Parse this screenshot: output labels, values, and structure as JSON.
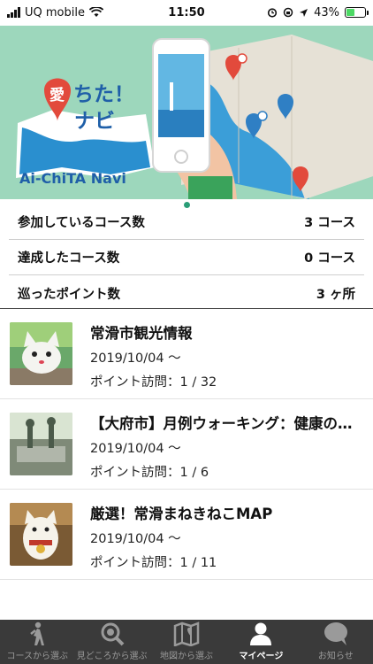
{
  "status_bar": {
    "carrier": "UQ mobile",
    "time": "11:50",
    "battery": "43%"
  },
  "banner": {
    "logo_line1": "愛ちた！",
    "logo_line2": "ナビ",
    "brand": "Ai-ChiTA Navi"
  },
  "stats": [
    {
      "label": "参加しているコース数",
      "value": "3 コース"
    },
    {
      "label": "達成したコース数",
      "value": "0 コース"
    },
    {
      "label": "巡ったポイント数",
      "value": "3 ヶ所"
    }
  ],
  "courses": [
    {
      "title": "常滑市観光情報",
      "date": "2019/10/04 ～",
      "visits": "ポイント訪問：1 / 32"
    },
    {
      "title": "【大府市】月例ウォーキング：健康の…",
      "date": "2019/10/04 ～",
      "visits": "ポイント訪問：1 / 6"
    },
    {
      "title": "厳選！常滑まねきねこMAP",
      "date": "2019/10/04 ～",
      "visits": "ポイント訪問：1 / 11"
    }
  ],
  "tabs": [
    {
      "label": "コースから選ぶ",
      "icon": "walker-icon"
    },
    {
      "label": "見どころから選ぶ",
      "icon": "magnifier-icon"
    },
    {
      "label": "地図から選ぶ",
      "icon": "map-icon"
    },
    {
      "label": "マイページ",
      "icon": "person-icon"
    },
    {
      "label": "お知らせ",
      "icon": "speech-bubble-icon"
    }
  ]
}
